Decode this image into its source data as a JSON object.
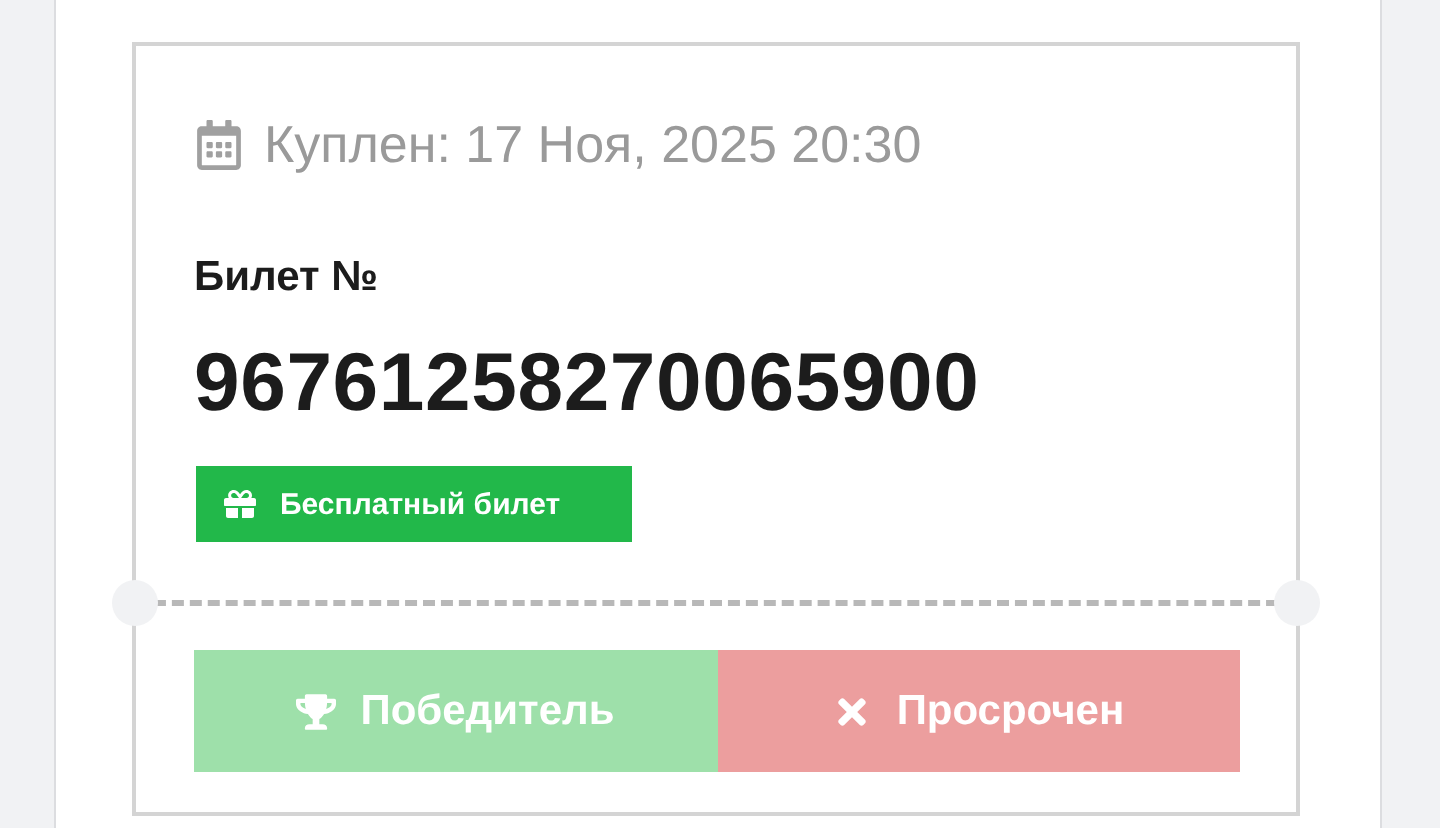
{
  "ticket": {
    "purchased": "Куплен: 17 Ноя, 2025 20:30",
    "number_label": "Билет №",
    "number": "96761258270065900",
    "badge": {
      "label": "Бесплатный билет"
    },
    "statuses": [
      {
        "kind": "winner",
        "label": "Победитель"
      },
      {
        "kind": "expired",
        "label": "Просрочен"
      }
    ]
  }
}
